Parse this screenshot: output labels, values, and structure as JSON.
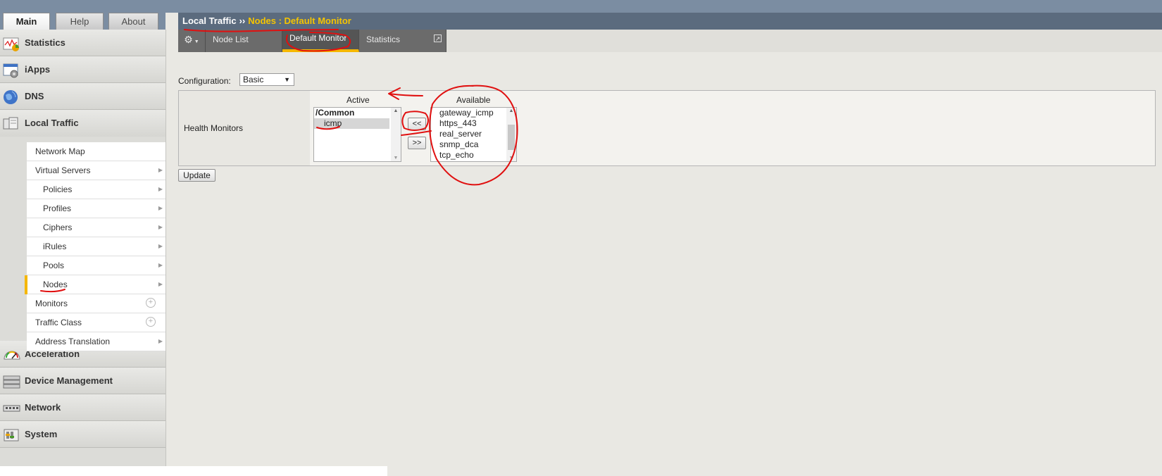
{
  "top_tabs": {
    "main": "Main",
    "help": "Help",
    "about": "About"
  },
  "breadcrumb": {
    "section": "Local Traffic",
    "separator": "››",
    "current": "Nodes : Default Monitor"
  },
  "sidebar": {
    "sections": {
      "statistics": "Statistics",
      "iapps": "iApps",
      "dns": "DNS",
      "local_traffic": "Local Traffic",
      "acceleration": "Acceleration",
      "device_management": "Device Management",
      "network": "Network",
      "system": "System"
    },
    "local_traffic_items": {
      "network_map": "Network Map",
      "virtual_servers": "Virtual Servers",
      "policies": "Policies",
      "profiles": "Profiles",
      "ciphers": "Ciphers",
      "irules": "iRules",
      "pools": "Pools",
      "nodes": "Nodes",
      "monitors": "Monitors",
      "traffic_class": "Traffic Class",
      "address_translation": "Address Translation"
    },
    "selected_item": "Nodes"
  },
  "content_tabs": {
    "node_list": "Node List",
    "default_monitor": "Default Monitor",
    "statistics": "Statistics"
  },
  "configuration": {
    "label": "Configuration:",
    "value": "Basic"
  },
  "health_monitors": {
    "label": "Health Monitors",
    "active_header": "Active",
    "available_header": "Available",
    "active_group": "/Common",
    "active_items": [
      "icmp"
    ],
    "available_items": [
      "gateway_icmp",
      "https_443",
      "real_server",
      "snmp_dca",
      "tcp_echo"
    ],
    "move_left": "<<",
    "move_right": ">>"
  },
  "update_button": "Update",
  "colors": {
    "accent": "#f5b700",
    "breadcrumb_bg": "#5b6b7e",
    "annotation": "#e01010"
  }
}
